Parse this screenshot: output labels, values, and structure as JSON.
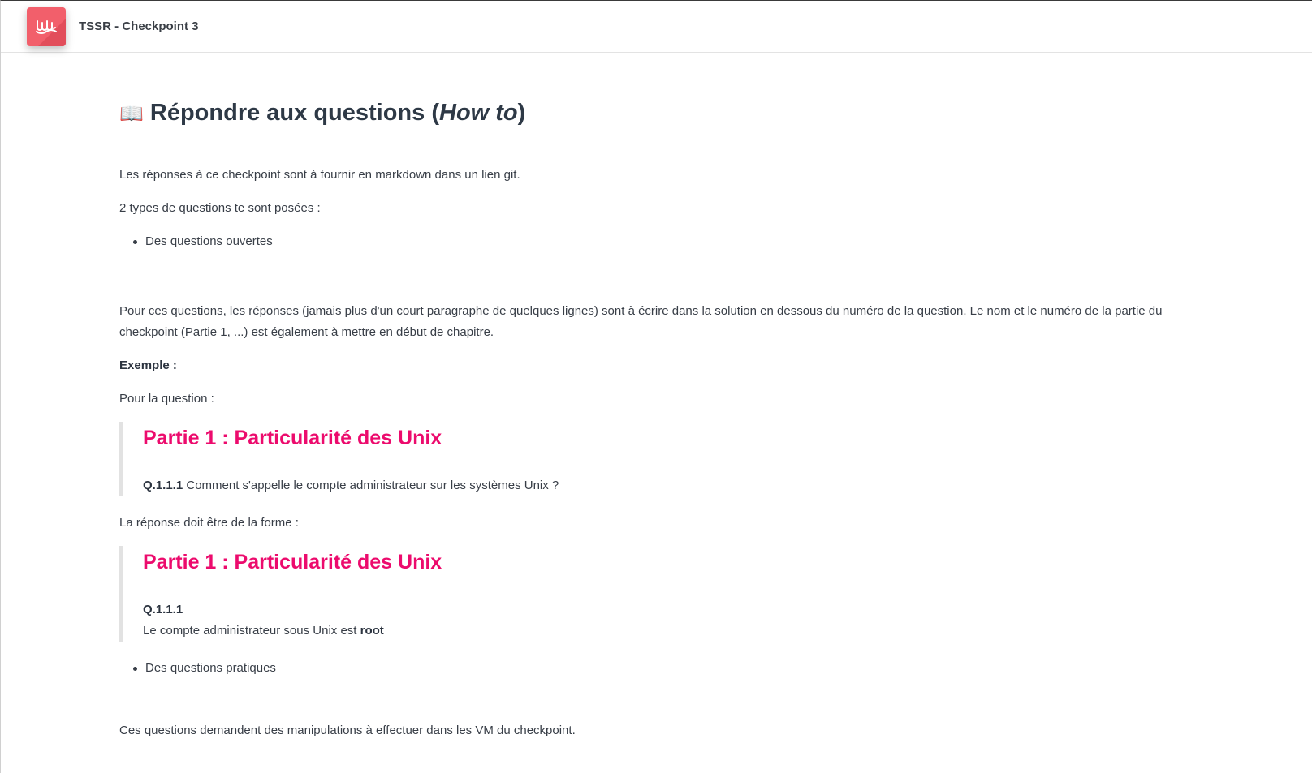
{
  "app": {
    "title": "TSSR - Checkpoint 3"
  },
  "doc": {
    "heading_icon": "📖",
    "heading_text": "Répondre aux questions (",
    "heading_em": "How to",
    "heading_close": ")",
    "intro": "Les réponses à ce checkpoint sont à fournir en markdown dans un lien git.",
    "types_intro": "2 types de questions te sont posées :",
    "bullet_open": "Des questions ouvertes",
    "open_desc": "Pour ces questions, les réponses (jamais plus d'un court paragraphe de quelques lignes) sont à écrire dans la solution en dessous du numéro de la question. Le nom et le numéro de la partie du checkpoint (Partie 1, ...) est également à mettre en début de chapitre.",
    "example_label": "Exemple :",
    "question_intro": "Pour la question :",
    "example_question": {
      "part_title": "Partie 1 : Particularité des Unix",
      "q_id": "Q.1.1.1",
      "q_text": " Comment s'appelle le compte administrateur sur les systèmes Unix ?"
    },
    "answer_intro": "La réponse doit être de la forme :",
    "example_answer": {
      "part_title": "Partie 1 : Particularité des Unix",
      "q_id": "Q.1.1.1",
      "a_text": "Le compte administrateur sous Unix est ",
      "a_bold": "root"
    },
    "bullet_practical": "Des questions pratiques",
    "cut_line": "Ces questions demandent des manipulations à effectuer dans les VM du checkpoint."
  },
  "colors": {
    "accent": "#ec0b6d",
    "logo": "#f25f6b",
    "text": "#383e47"
  }
}
